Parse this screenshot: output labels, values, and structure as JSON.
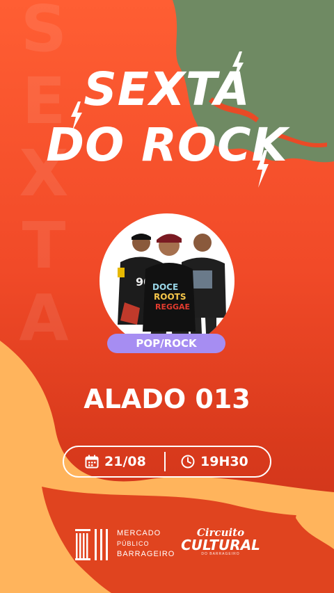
{
  "background_word": "SEXTA",
  "title": {
    "line1": "SEXTA",
    "line2": "DO ROCK"
  },
  "genre": "POP/ROCK",
  "artist": "ALADO 013",
  "event": {
    "date": "21/08",
    "time": "19H30"
  },
  "logos": {
    "mercado": [
      "MERCADO",
      "PÚBLICO",
      "BARRAGEIRO"
    ],
    "circuito": {
      "top": "Circuito",
      "main": "CULTURAL",
      "sub": "DO BARRAGEIRO"
    }
  },
  "colors": {
    "background": "#f14a28",
    "green_accent": "#6f8a63",
    "yellow_accent": "#ffb45c",
    "genre_pill": "#a68df2",
    "text": "#ffffff"
  },
  "icons": [
    "lightning-bolt-icon",
    "calendar-icon",
    "clock-icon"
  ]
}
